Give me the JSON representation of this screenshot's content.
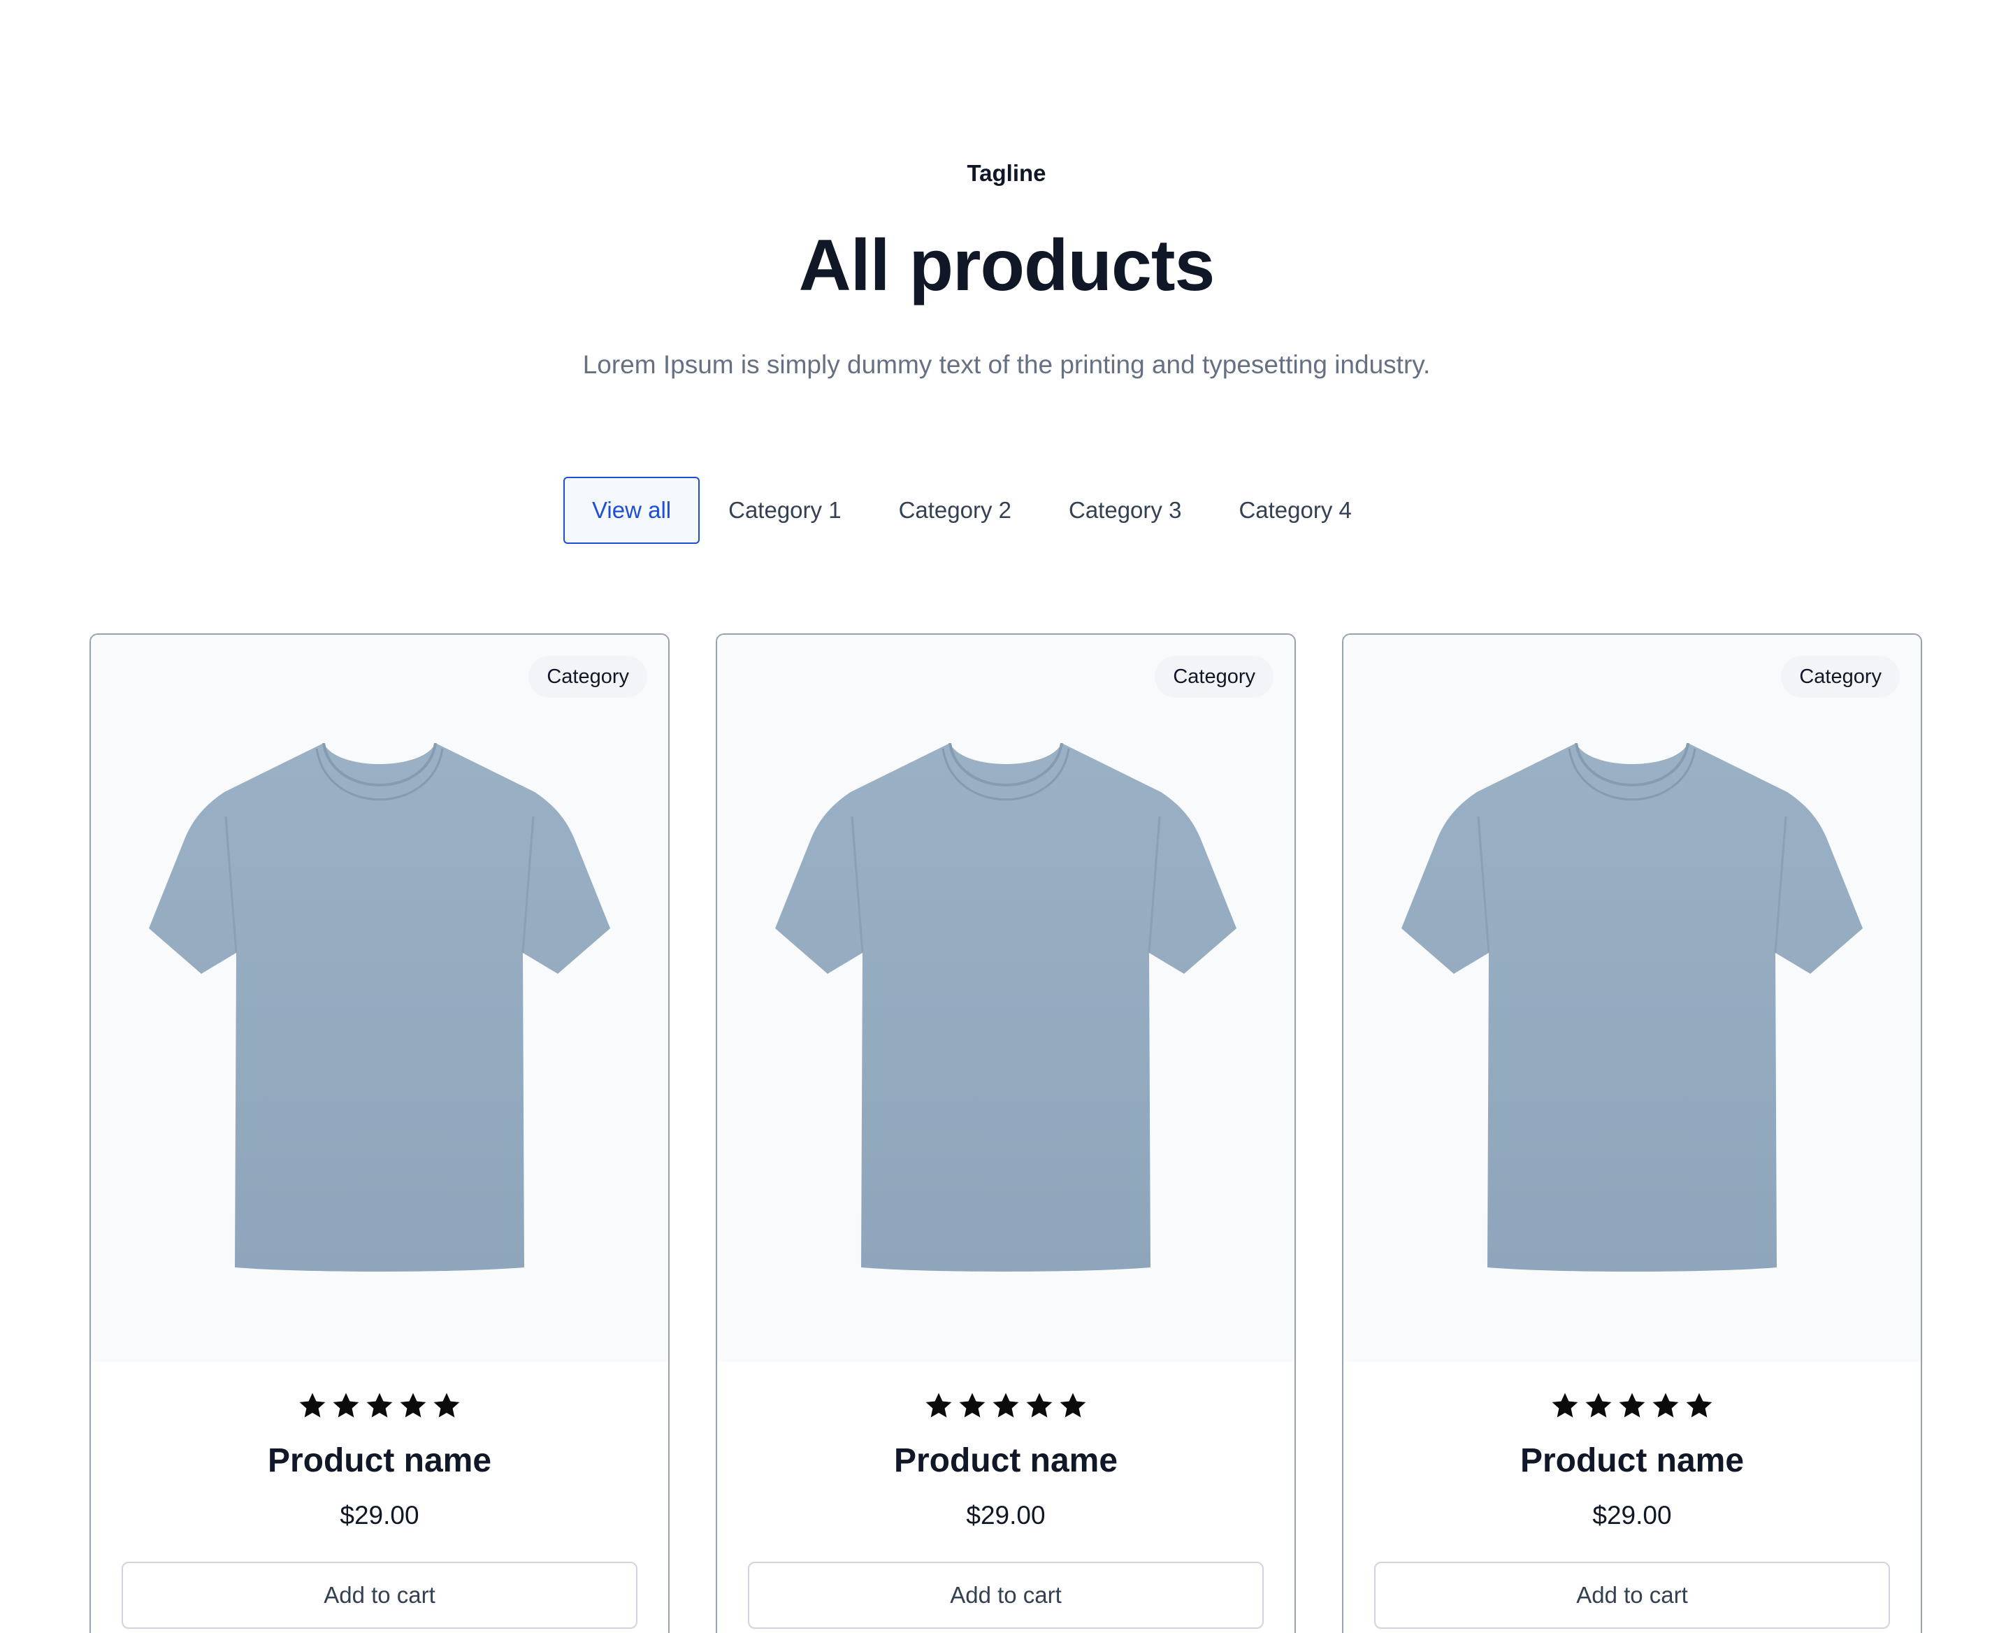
{
  "header": {
    "tagline": "Tagline",
    "title": "All products",
    "subtitle": "Lorem Ipsum is simply dummy text of the printing and typesetting industry."
  },
  "tabs": [
    {
      "label": "View all",
      "active": true
    },
    {
      "label": "Category 1",
      "active": false
    },
    {
      "label": "Category 2",
      "active": false
    },
    {
      "label": "Category 3",
      "active": false
    },
    {
      "label": "Category 4",
      "active": false
    }
  ],
  "products": [
    {
      "badge": "Category",
      "name": "Product name",
      "price": "$29.00",
      "rating": 5,
      "cta": "Add to cart"
    },
    {
      "badge": "Category",
      "name": "Product name",
      "price": "$29.00",
      "rating": 5,
      "cta": "Add to cart"
    },
    {
      "badge": "Category",
      "name": "Product name",
      "price": "$29.00",
      "rating": 5,
      "cta": "Add to cart"
    }
  ],
  "colors": {
    "accent": "#1d4ed8",
    "tshirt": "#93a9be",
    "text": "#101828",
    "muted": "#667085"
  },
  "icons": {
    "star": "star-icon",
    "product_image": "tshirt-image"
  }
}
